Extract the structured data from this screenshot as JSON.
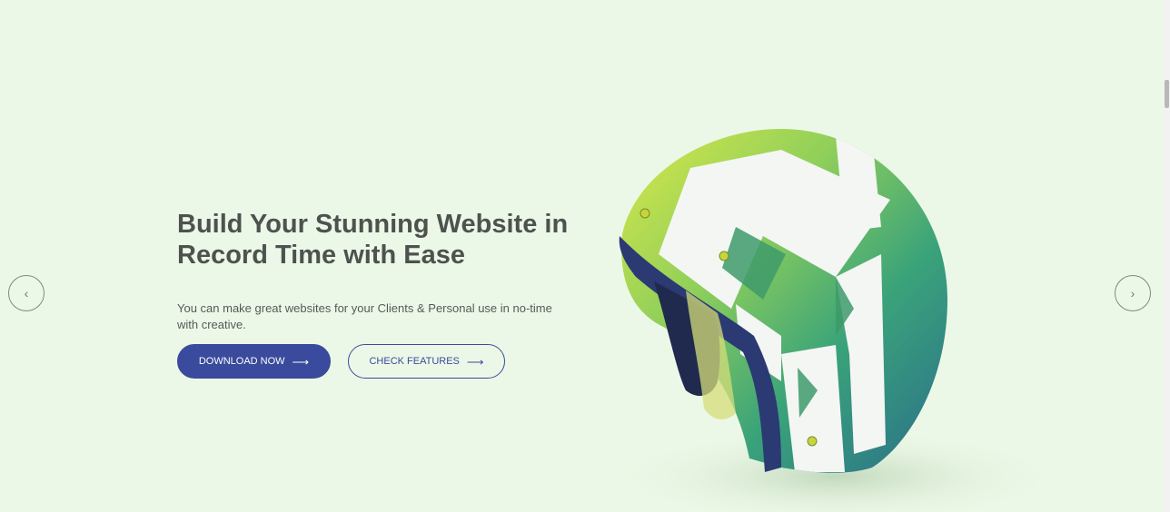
{
  "hero": {
    "headline": "Build Your Stunning Website in Record Time with Ease",
    "description": "You can make great websites for your Clients & Personal use in no-time with creative.",
    "primary_button": "DOWNLOAD NOW",
    "secondary_button": "CHECK FEATURES",
    "arrow_glyph": "⟶"
  },
  "carousel": {
    "prev_glyph": "‹",
    "next_glyph": "›"
  },
  "colors": {
    "background": "#ecf8e7",
    "primary": "#3a4a9c",
    "heading": "#4d524f"
  },
  "icons": [
    "arrow-right-icon",
    "chevron-left-icon",
    "chevron-right-icon"
  ]
}
